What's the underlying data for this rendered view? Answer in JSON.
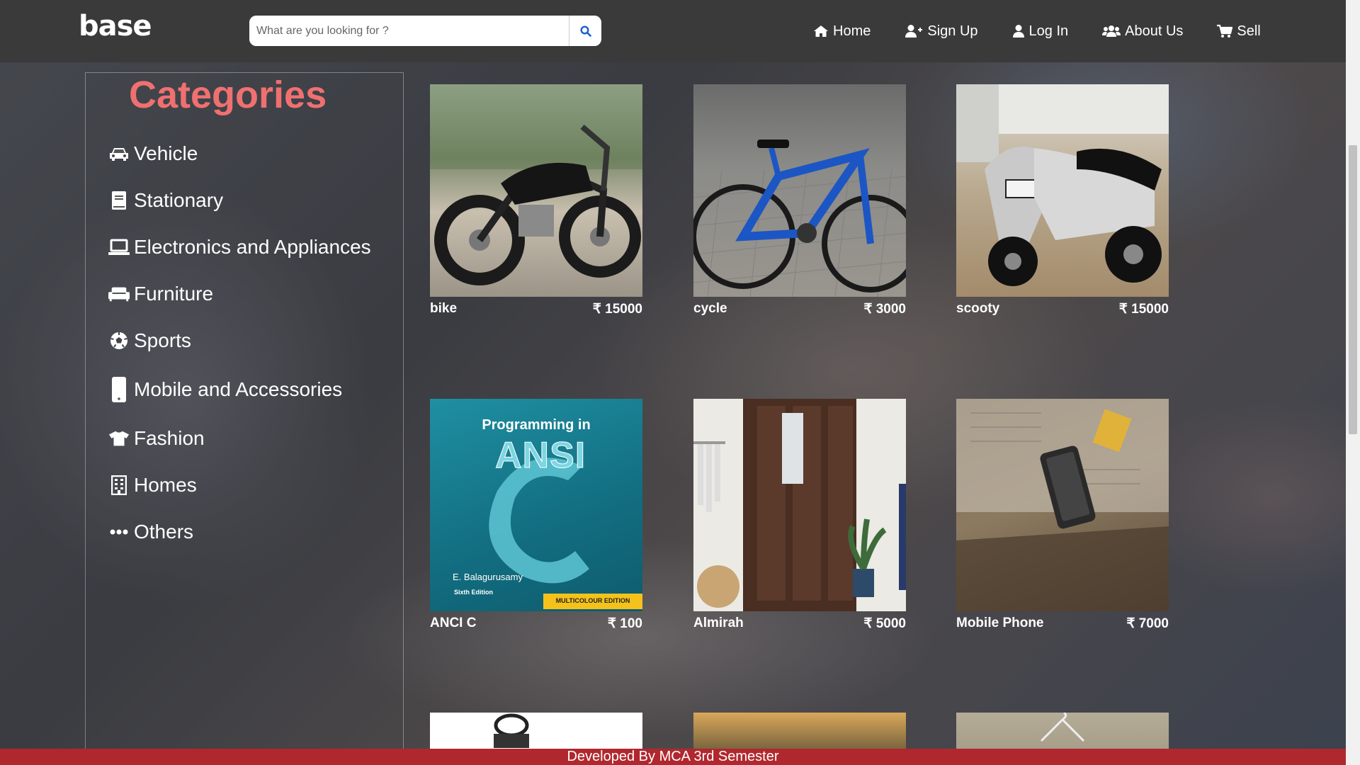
{
  "brand": {
    "logo_text": "base"
  },
  "search": {
    "placeholder": "What are you looking for ?"
  },
  "nav": {
    "items": [
      {
        "label": "Home",
        "icon": "home-icon"
      },
      {
        "label": "Sign Up",
        "icon": "user-plus-icon"
      },
      {
        "label": "Log In",
        "icon": "user-icon"
      },
      {
        "label": "About Us",
        "icon": "users-icon"
      },
      {
        "label": "Sell",
        "icon": "cart-icon"
      }
    ]
  },
  "sidebar": {
    "title": "Categories",
    "items": [
      {
        "label": "Vehicle",
        "icon": "car-icon"
      },
      {
        "label": "Stationary",
        "icon": "book-icon"
      },
      {
        "label": "Electronics and Appliances",
        "icon": "laptop-icon"
      },
      {
        "label": "Furniture",
        "icon": "couch-icon"
      },
      {
        "label": "Sports",
        "icon": "football-icon"
      },
      {
        "label": "Mobile and Accessories",
        "icon": "mobile-icon"
      },
      {
        "label": "Fashion",
        "icon": "tshirt-icon"
      },
      {
        "label": "Homes",
        "icon": "building-icon"
      },
      {
        "label": "Others",
        "icon": "ellipsis-icon"
      }
    ]
  },
  "products": [
    {
      "name": "bike",
      "price": "₹ 15000"
    },
    {
      "name": "cycle",
      "price": "₹ 3000"
    },
    {
      "name": "scooty",
      "price": "₹ 15000"
    },
    {
      "name": "ANCI C",
      "price": "₹ 100"
    },
    {
      "name": "Almirah",
      "price": "₹ 5000"
    },
    {
      "name": "Mobile Phone",
      "price": "₹ 7000"
    }
  ],
  "book_cover": {
    "line1": "Programming in",
    "line2": "ANSI",
    "author": "E. Balagurusamy",
    "edition": "Sixth Edition",
    "badge": "MULTICOLOUR EDITION"
  },
  "footer": {
    "text": "Developed By MCA 3rd Semester"
  },
  "colors": {
    "navbar": "#3a3a3a",
    "accent": "#f07070",
    "footer": "#b0282e",
    "search_icon": "#1a5fd0"
  }
}
